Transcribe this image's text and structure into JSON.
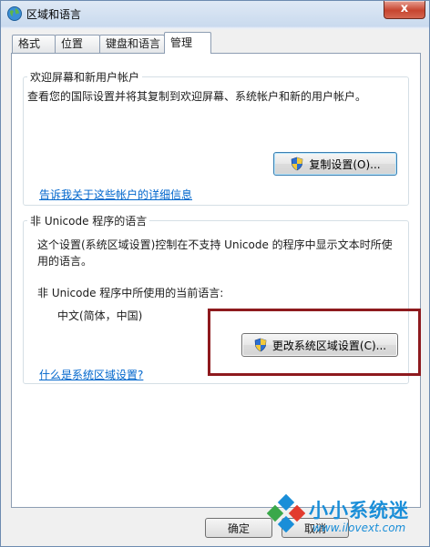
{
  "window": {
    "title": "区域和语言",
    "close_glyph": "x"
  },
  "tabs": [
    {
      "label": "格式"
    },
    {
      "label": "位置"
    },
    {
      "label": "键盘和语言"
    },
    {
      "label": "管理",
      "active": true
    }
  ],
  "welcome_group": {
    "title": "欢迎屏幕和新用户帐户",
    "description": "查看您的国际设置并将其复制到欢迎屏幕、系统帐户和新的用户帐户。",
    "copy_button": "复制设置(O)...",
    "link": "告诉我关于这些帐户的详细信息"
  },
  "nonunicode_group": {
    "title": "非 Unicode 程序的语言",
    "description_line1": "这个设置(系统区域设置)控制在不支持 Unicode 的程序中显示文本时所使",
    "description_line2": "用的语言。",
    "current_label": "非 Unicode 程序中所使用的当前语言:",
    "current_value": "中文(简体，中国)",
    "change_button": "更改系统区域设置(C)...",
    "link": "什么是系统区域设置?"
  },
  "footer": {
    "ok_button": "确定",
    "cancel_button_partial": "取消"
  },
  "watermark": {
    "title": "小小系统迷",
    "url": "www.ilovext.com"
  },
  "colors": {
    "highlight": "#8e1a1e",
    "link": "#0066cc",
    "watermark": "#1a8ed8"
  }
}
